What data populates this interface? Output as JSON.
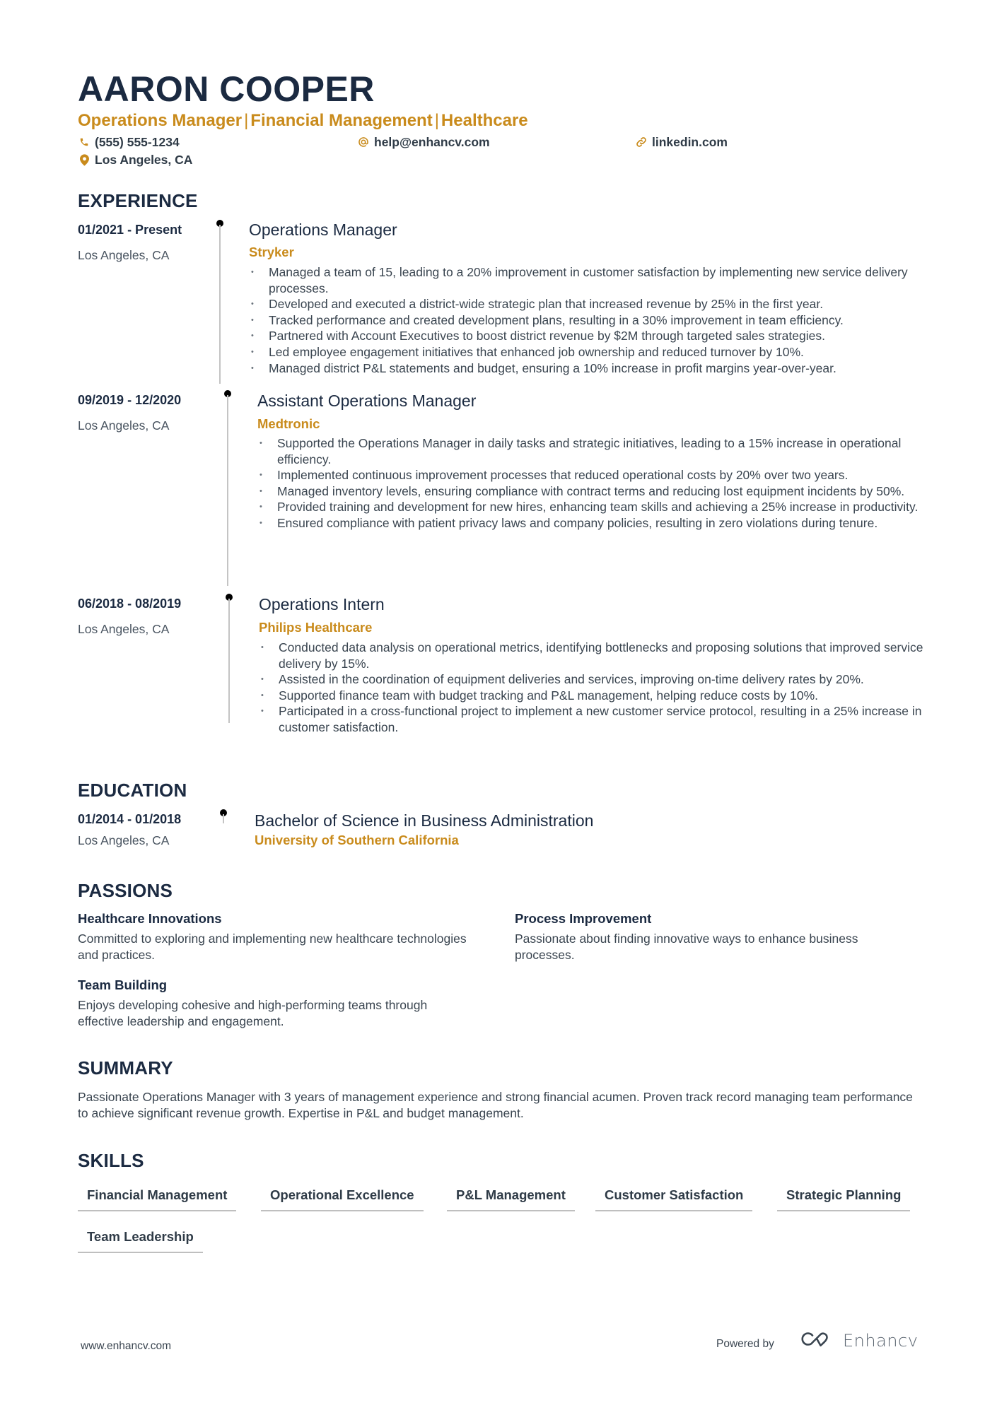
{
  "header": {
    "name": "AARON COOPER",
    "title_parts": [
      "Operations Manager",
      "Financial Management",
      "Healthcare"
    ],
    "title_separator": "|",
    "phone": "(555) 555-1234",
    "email": "help@enhancv.com",
    "website": "linkedin.com",
    "location": "Los Angeles, CA",
    "icons": {
      "phone": "phone-icon",
      "email": "at-icon",
      "website": "link-icon",
      "location": "map-pin-icon"
    },
    "accent_color": "#c98b1c"
  },
  "experience": {
    "heading": "EXPERIENCE",
    "entries": [
      {
        "dates": "01/2021 - Present",
        "location": "Los Angeles, CA",
        "role": "Operations Manager",
        "company": "Stryker",
        "bullets": [
          "Managed a team of 15, leading to a 20% improvement in customer satisfaction by implementing new service delivery processes.",
          "Developed and executed a district-wide strategic plan that increased revenue by 25% in the first year.",
          "Tracked performance and created development plans, resulting in a 30% improvement in team efficiency.",
          "Partnered with Account Executives to boost district revenue by $2M through targeted sales strategies.",
          "Led employee engagement initiatives that enhanced job ownership and reduced turnover by 10%.",
          "Managed district P&L statements and budget, ensuring a 10% increase in profit margins year-over-year."
        ]
      },
      {
        "dates": "09/2019 - 12/2020",
        "location": "Los Angeles, CA",
        "role": "Assistant Operations Manager",
        "company": "Medtronic",
        "bullets": [
          "Supported the Operations Manager in daily tasks and strategic initiatives, leading to a 15% increase in operational efficiency.",
          "Implemented continuous improvement processes that reduced operational costs by 20% over two years.",
          "Managed inventory levels, ensuring compliance with contract terms and reducing lost equipment incidents by 50%.",
          "Provided training and development for new hires, enhancing team skills and achieving a 25% increase in productivity.",
          "Ensured compliance with patient privacy laws and company policies, resulting in zero violations during tenure."
        ]
      },
      {
        "dates": "06/2018 - 08/2019",
        "location": "Los Angeles, CA",
        "role": "Operations Intern",
        "company": "Philips Healthcare",
        "bullets": [
          "Conducted data analysis on operational metrics, identifying bottlenecks and proposing solutions that improved service delivery by 15%.",
          "Assisted in the coordination of equipment deliveries and services, improving on-time delivery rates by 20%.",
          "Supported finance team with budget tracking and P&L management, helping reduce costs by 10%.",
          "Participated in a cross-functional project to implement a new customer service protocol, resulting in a 25% increase in customer satisfaction."
        ]
      }
    ]
  },
  "education": {
    "heading": "EDUCATION",
    "entries": [
      {
        "dates": "01/2014 - 01/2018",
        "location": "Los Angeles, CA",
        "degree": "Bachelor of Science in Business Administration",
        "school": "University of Southern California"
      }
    ]
  },
  "passions": {
    "heading": "PASSIONS",
    "items": [
      {
        "title": "Healthcare Innovations",
        "description": "Committed to exploring and implementing new healthcare technologies and practices."
      },
      {
        "title": "Process Improvement",
        "description": "Passionate about finding innovative ways to enhance business processes."
      },
      {
        "title": "Team Building",
        "description": "Enjoys developing cohesive and high-performing teams through effective leadership and engagement."
      }
    ]
  },
  "summary": {
    "heading": "SUMMARY",
    "text": "Passionate Operations Manager with 3 years of management experience and strong financial acumen. Proven track record managing team performance to achieve significant revenue growth. Expertise in P&L and budget management."
  },
  "skills": {
    "heading": "SKILLS",
    "items": [
      "Financial Management",
      "Operational Excellence",
      "P&L Management",
      "Customer Satisfaction",
      "Strategic Planning",
      "Team Leadership"
    ]
  },
  "footer": {
    "website": "www.enhancv.com",
    "powered_by": "Powered by",
    "brand": "Enhancv"
  }
}
